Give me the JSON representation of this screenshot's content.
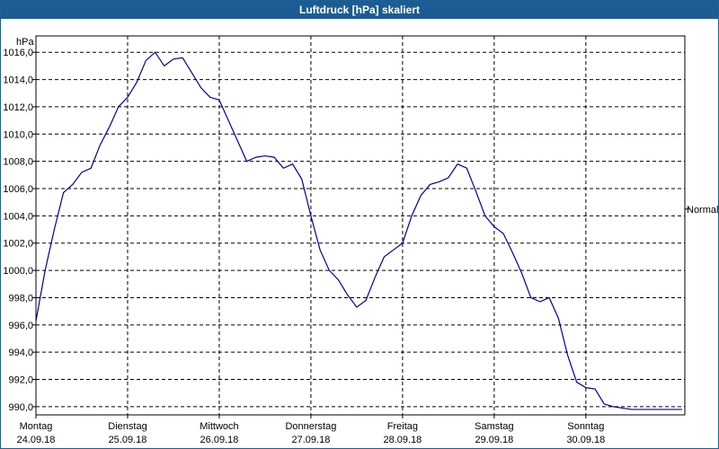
{
  "window": {
    "title": "Luftdruck [hPa] skaliert"
  },
  "chart_data": {
    "type": "line",
    "title": "Luftdruck [hPa] skaliert",
    "ylabel": "hPa",
    "ylim": [
      989.4,
      1017.2
    ],
    "yticks": [
      "990,0",
      "992,0",
      "994,0",
      "996,0",
      "998,0",
      "1000,0",
      "1002,0",
      "1004,0",
      "1006,0",
      "1008,0",
      "1010,0",
      "1012,0",
      "1014,0",
      "1016,0"
    ],
    "ytick_values": [
      990,
      992,
      994,
      996,
      998,
      1000,
      1002,
      1004,
      1006,
      1008,
      1010,
      1012,
      1014,
      1016
    ],
    "xlim": [
      0,
      7.08
    ],
    "days": [
      {
        "day": "Montag",
        "date": "24.09.18"
      },
      {
        "day": "Dienstag",
        "date": "25.09.18"
      },
      {
        "day": "Mittwoch",
        "date": "26.09.18"
      },
      {
        "day": "Donnerstag",
        "date": "27.09.18"
      },
      {
        "day": "Freitag",
        "date": "28.09.18"
      },
      {
        "day": "Samstag",
        "date": "29.09.18"
      },
      {
        "day": "Sonntag",
        "date": "30.09.18"
      }
    ],
    "annotation": {
      "label": "Normal",
      "value": 1004.5
    },
    "grid": true,
    "series": [
      {
        "color": "#0000a0",
        "x": [
          0.0,
          0.1,
          0.2,
          0.3,
          0.4,
          0.5,
          0.6,
          0.7,
          0.8,
          0.9,
          1.0,
          1.1,
          1.2,
          1.3,
          1.4,
          1.5,
          1.6,
          1.7,
          1.8,
          1.9,
          2.0,
          2.1,
          2.2,
          2.3,
          2.4,
          2.5,
          2.6,
          2.7,
          2.8,
          2.9,
          3.0,
          3.1,
          3.2,
          3.3,
          3.4,
          3.5,
          3.6,
          3.7,
          3.8,
          3.9,
          4.0,
          4.1,
          4.2,
          4.3,
          4.4,
          4.5,
          4.6,
          4.7,
          4.8,
          4.9,
          5.0,
          5.1,
          5.2,
          5.3,
          5.4,
          5.5,
          5.6,
          5.7,
          5.8,
          5.9,
          6.0,
          6.1,
          6.2,
          6.3,
          6.4,
          6.5,
          6.6,
          6.7,
          6.8,
          6.9,
          7.0,
          7.05
        ],
        "y": [
          996.3,
          1000.0,
          1003.0,
          1005.7,
          1006.3,
          1007.2,
          1007.5,
          1009.2,
          1010.5,
          1012.0,
          1012.7,
          1013.8,
          1015.4,
          1016.0,
          1015.0,
          1015.5,
          1015.6,
          1014.5,
          1013.4,
          1012.7,
          1012.5,
          1011.0,
          1009.5,
          1008.0,
          1008.3,
          1008.4,
          1008.3,
          1007.5,
          1007.8,
          1006.7,
          1004.0,
          1001.5,
          1000.0,
          999.3,
          998.2,
          997.3,
          997.8,
          999.5,
          1001.0,
          1001.5,
          1002.0,
          1004.0,
          1005.5,
          1006.3,
          1006.5,
          1006.8,
          1007.8,
          1007.5,
          1005.8,
          1004.0,
          1003.2,
          1002.7,
          1001.3,
          999.8,
          998.0,
          997.7,
          998.0,
          996.5,
          993.8,
          991.8,
          991.4,
          991.3,
          990.2,
          990.0,
          989.9,
          989.8,
          989.8,
          989.8,
          989.8,
          989.8,
          989.8,
          989.8
        ]
      }
    ]
  }
}
